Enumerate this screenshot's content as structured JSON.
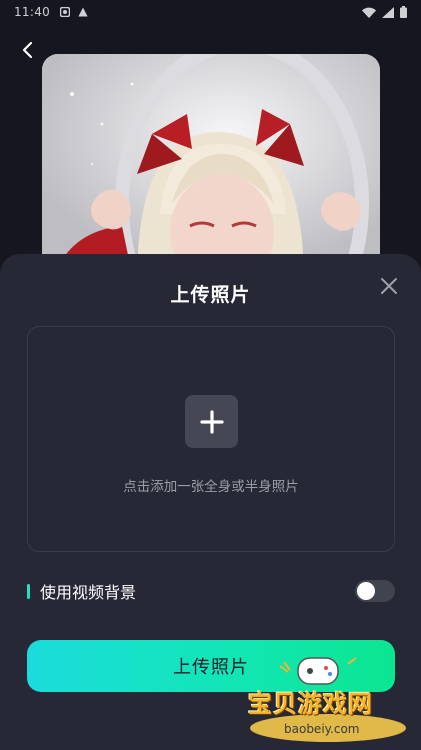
{
  "status_bar": {
    "time": "11:40"
  },
  "sheet": {
    "title": "上传照片",
    "upload_hint": "点击添加一张全身或半身照片",
    "background_toggle_label": "使用视频背景",
    "background_toggle_on": false,
    "primary_button_label": "上传照片"
  },
  "watermark": {
    "brand": "宝贝游戏网",
    "url": "baobeiy.com"
  },
  "colors": {
    "background": "#15161f",
    "sheet": "#262836",
    "accent": "#24e0c2",
    "button_gradient_start": "#1bdcdc",
    "button_gradient_end": "#0be58f"
  },
  "icons": {
    "back": "chevron-left-icon",
    "close": "close-icon",
    "add": "plus-icon"
  }
}
